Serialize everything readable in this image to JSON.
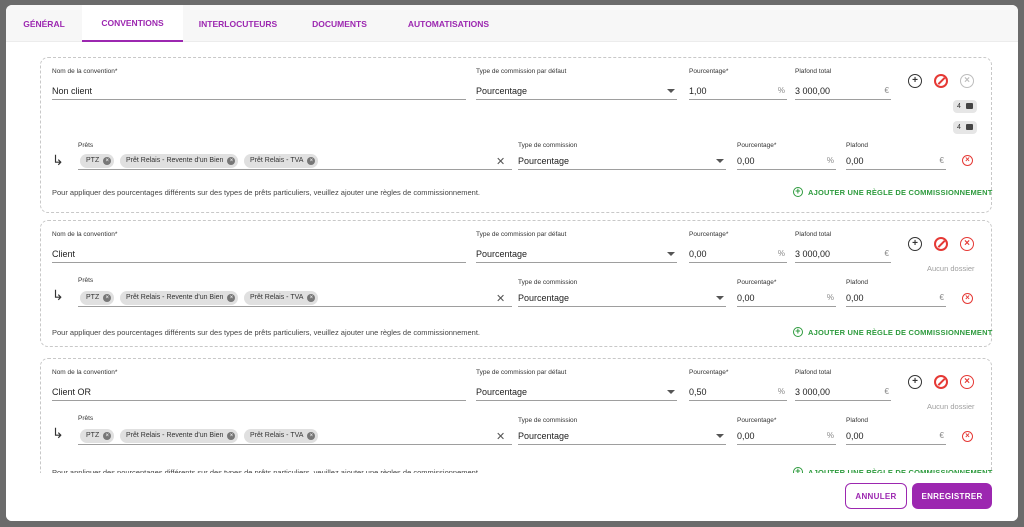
{
  "tabs": [
    "GÉNÉRAL",
    "CONVENTIONS",
    "INTERLOCUTEURS",
    "DOCUMENTS",
    "AUTOMATISATIONS"
  ],
  "labels": {
    "convention_name": "Nom de la convention",
    "required_star": "*",
    "default_type": "Type de commission par défaut",
    "percentage": "Pourcentage",
    "total_cap": "Plafond total",
    "loans": "Prêts",
    "commission_type": "Type de commission",
    "cap": "Plafond"
  },
  "units": {
    "percent": "%",
    "euro": "€"
  },
  "hint": "Pour appliquer des pourcentages différents sur des types de prêts particuliers, veuillez ajouter une règles de commissionnement.",
  "add_rule": "AJOUTER UNE RÈGLE DE COMMISSIONNEMENT",
  "conventions": [
    {
      "name": "Non client",
      "default_type": "Pourcentage",
      "percentage": "1,00",
      "total_cap": "3 000,00",
      "badges": [
        "4",
        "4"
      ],
      "no_file": "",
      "rule": {
        "loans": [
          "PTZ",
          "Prêt Relais - Revente d'un Bien",
          "Prêt Relais - TVA"
        ],
        "type": "Pourcentage",
        "percentage": "0,00",
        "cap": "0,00"
      }
    },
    {
      "name": "Client",
      "default_type": "Pourcentage",
      "percentage": "0,00",
      "total_cap": "3 000,00",
      "badges": [],
      "no_file": "Aucun dossier",
      "rule": {
        "loans": [
          "PTZ",
          "Prêt Relais - Revente d'un Bien",
          "Prêt Relais - TVA"
        ],
        "type": "Pourcentage",
        "percentage": "0,00",
        "cap": "0,00"
      }
    },
    {
      "name": "Client OR",
      "default_type": "Pourcentage",
      "percentage": "0,50",
      "total_cap": "3 000,00",
      "badges": [],
      "no_file": "Aucun dossier",
      "rule": {
        "loans": [
          "PTZ",
          "Prêt Relais - Revente d'un Bien",
          "Prêt Relais - TVA"
        ],
        "type": "Pourcentage",
        "percentage": "0,00",
        "cap": "0,00"
      }
    }
  ],
  "footer": {
    "cancel": "ANNULER",
    "save": "ENREGISTRER"
  },
  "icons": {
    "add": "add-circle-icon",
    "ban": "block-icon",
    "delete": "close-circle-icon",
    "folder": "folder-icon",
    "file": "file-icon",
    "turn": "subdirectory-arrow-icon",
    "clear": "close-icon"
  },
  "colors": {
    "accent": "#9c27b0",
    "danger": "#e53935",
    "success": "#2e9b3e"
  }
}
